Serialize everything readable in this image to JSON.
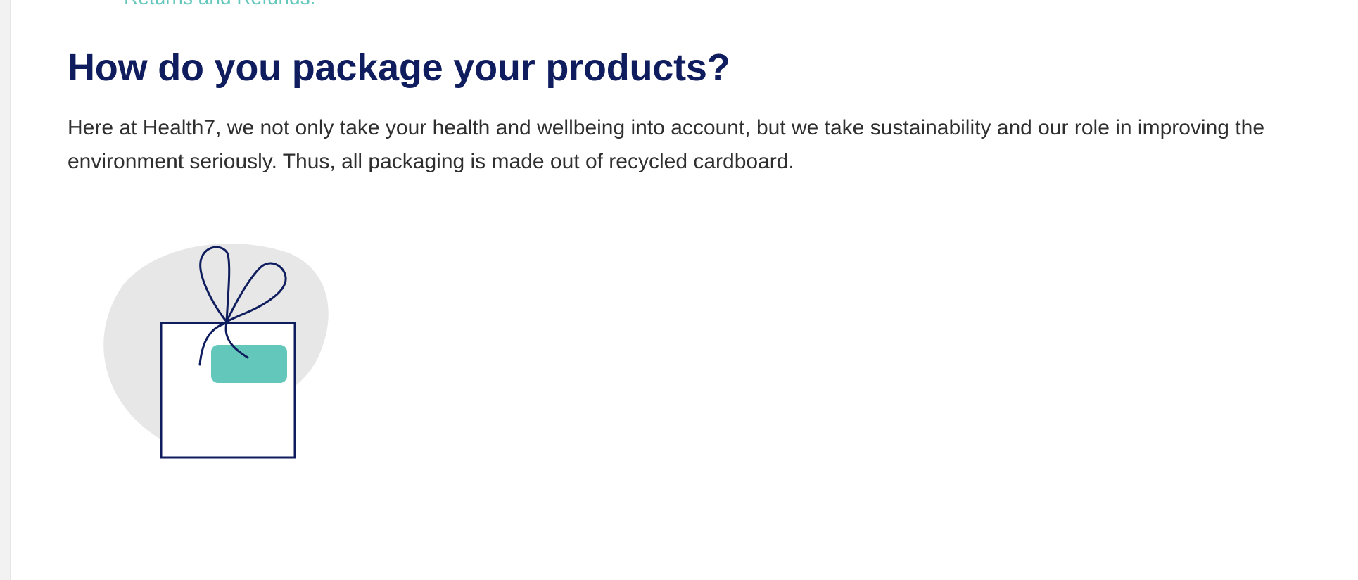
{
  "nav": {
    "previous_link": "Returns and Refunds."
  },
  "article": {
    "title": "How do you package your products?",
    "body": "Here at Health7, we not only take your health and wellbeing into account, but we take sustainability and our role in improving the environment seriously. Thus, all packaging is made out of recycled cardboard."
  },
  "illustration": {
    "icon": "gift-box-icon",
    "colors": {
      "navy": "#0f1d5e",
      "teal": "#63c7bb",
      "blob": "#e7e7e7"
    }
  },
  "colors": {
    "link_teal": "#63c7bb",
    "heading_navy": "#0f1d5e",
    "body_text": "#2f2f2f",
    "background": "#ffffff"
  }
}
